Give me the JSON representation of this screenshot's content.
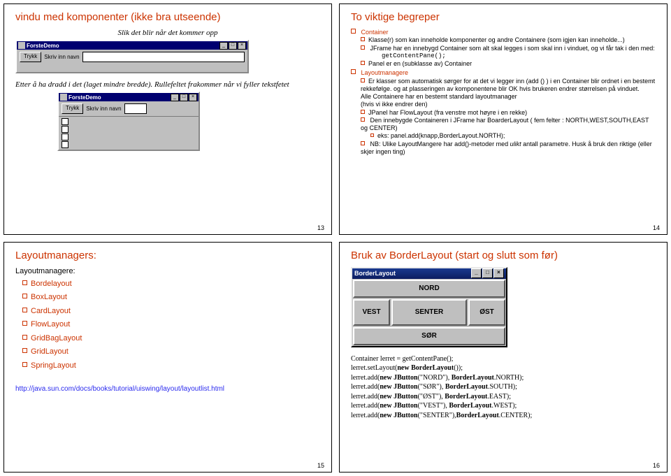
{
  "slide13": {
    "title": "vindu med komponenter (ikke bra utseende)",
    "line1": "Slik det blir når det kommer opp",
    "mock1": {
      "title": "ForsteDemo",
      "btn": "Trykk",
      "input_label": "Skriv inn navn"
    },
    "line2": "Etter å ha dradd i det (laget mindre bredde). Rullefeltet frakommer når vi fyller tekstfetet",
    "mock2": {
      "title": "ForsteDemo",
      "btn": "Trykk",
      "input_label": "Skriv inn navn"
    },
    "page": "13"
  },
  "slide14": {
    "title": "To viktige begreper",
    "container_h": "Container",
    "c1": "Klasse(r) som kan inneholde komponenter og andre Containere (som igjen kan inneholde...)",
    "c2": "JFrame har en innebygd Container som alt skal legges i som skal inn i vinduet, og vi får tak i den med:",
    "c2code": "getContentPane();",
    "c3": "Panel er en (subklasse av) Container",
    "lm_h": "Layoutmanagere",
    "l1": "Er klasser som automatisk sørger for at det vi legger inn (add () ) i en Container blir ordnet i en bestemt rekkefølge. og at plasseringen av komponentene blir OK hvis brukeren endrer størrelsen på vinduet.",
    "p1": "Alle Containere har en bestemt standard layoutmanager",
    "p2": "(hvis vi ikke endrer den)",
    "b1": "JPanel har FlowLayout (fra venstre mot høyre i en rekke)",
    "b2": "Den innebygde Containeren i JFrame har BoarderLayout ( fem felter : NORTH,WEST,SOUTH,EAST og CENTER)",
    "b2ex": "eks: panel.add(knapp,BorderLayout.NORTH);",
    "b3a": "NB: Ulike LayoutMangere har add()-metoder med ",
    "b3em": "ulikt",
    "b3b": " antall parametre. Husk å bruk den riktige (eller skjer ingen ting)",
    "page": "14"
  },
  "slide15": {
    "title": "Layoutmanagers:",
    "sub": "Layoutmanagere:",
    "items": [
      "Bordelayout",
      "BoxLayout",
      "CardLayout",
      "FlowLayout",
      "GridBagLayout",
      "GridLayout",
      "SpringLayout"
    ],
    "url": "http://java.sun.com/docs/books/tutorial/uiswing/layout/layoutlist.html",
    "page": "15"
  },
  "slide16": {
    "title": "Bruk av BorderLayout (start og slutt som før)",
    "win_title": "BorderLayout",
    "north": "NORD",
    "west": "VEST",
    "center": "SENTER",
    "east": "ØST",
    "south": "SØR",
    "code": [
      "Container lerret = getContentPane();",
      "lerret.setLayout(new BorderLayout());",
      "lerret.add(new JButton(\"NORD\"), BorderLayout.NORTH);",
      "lerret.add(new JButton(\"SØR\"),  BorderLayout.SOUTH);",
      "lerret.add(new JButton(\"ØST\"),  BorderLayout.EAST);",
      "lerret.add(new JButton(\"VEST\"), BorderLayout.WEST);",
      "lerret.add(new JButton(\"SENTER\"),BorderLayout.CENTER);"
    ],
    "page": "16"
  }
}
